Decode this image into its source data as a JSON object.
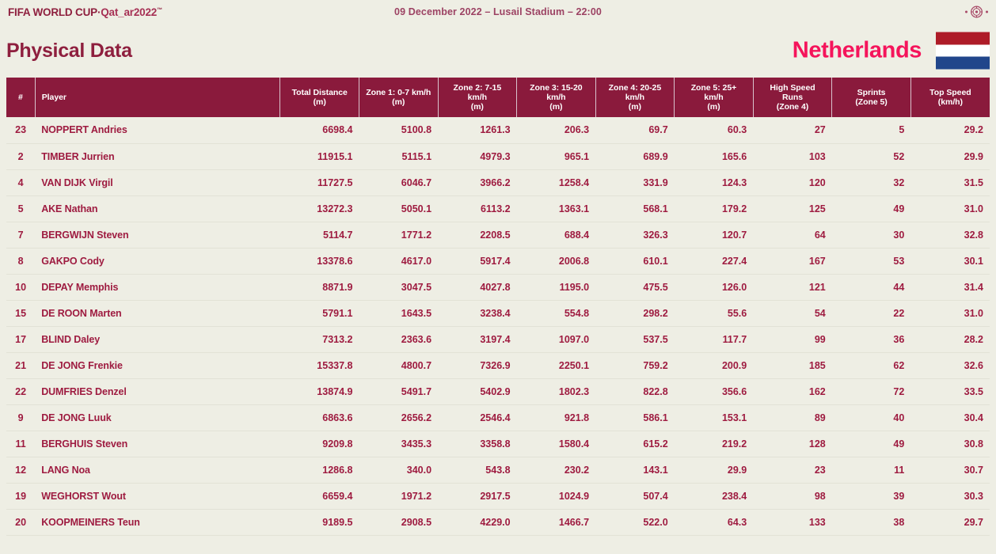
{
  "header": {
    "fifa_logo_main": "FIFA WORLD CUP",
    "fifa_logo_separator": "·",
    "fifa_logo_qatar": "Qat_ar2022",
    "fifa_logo_tm": "™",
    "match_info": "09 December 2022 – Lusail Stadium – 22:00",
    "emblem_icon": "fifa-emblem-icon"
  },
  "title": {
    "page_title": "Physical Data",
    "team_name": "Netherlands",
    "flag_icon": "netherlands-flag-icon"
  },
  "colors": {
    "page_background": "#eeeee4",
    "header_maroon": "#8a1a3c",
    "title_maroon": "#8e1f3e",
    "team_pink": "#f5145b",
    "data_text": "#9e1b40",
    "match_info_text": "#9c4263",
    "row_divider": "#e2e2d6",
    "flag_red": "#ae1c28",
    "flag_white": "#ffffff",
    "flag_blue": "#21468b"
  },
  "table": {
    "columns": [
      {
        "key": "num",
        "label": "#",
        "sub": ""
      },
      {
        "key": "player",
        "label": "Player",
        "sub": ""
      },
      {
        "key": "total",
        "label": "Total Distance",
        "sub": "(m)"
      },
      {
        "key": "zone1",
        "label": "Zone 1: 0-7 km/h",
        "sub": "(m)"
      },
      {
        "key": "zone2",
        "label": "Zone 2: 7-15 km/h",
        "sub": "(m)"
      },
      {
        "key": "zone3",
        "label": "Zone 3: 15-20 km/h",
        "sub": "(m)"
      },
      {
        "key": "zone4",
        "label": "Zone 4: 20-25 km/h",
        "sub": "(m)"
      },
      {
        "key": "zone5",
        "label": "Zone 5: 25+ km/h",
        "sub": "(m)"
      },
      {
        "key": "hsr",
        "label": "High Speed Runs",
        "sub": "(Zone 4)"
      },
      {
        "key": "sprints",
        "label": "Sprints",
        "sub": "(Zone 5)"
      },
      {
        "key": "topspeed",
        "label": "Top Speed",
        "sub": "(km/h)"
      }
    ],
    "rows": [
      {
        "num": "23",
        "player": "NOPPERT Andries",
        "total": "6698.4",
        "zone1": "5100.8",
        "zone2": "1261.3",
        "zone3": "206.3",
        "zone4": "69.7",
        "zone5": "60.3",
        "hsr": "27",
        "sprints": "5",
        "topspeed": "29.2"
      },
      {
        "num": "2",
        "player": "TIMBER Jurrien",
        "total": "11915.1",
        "zone1": "5115.1",
        "zone2": "4979.3",
        "zone3": "965.1",
        "zone4": "689.9",
        "zone5": "165.6",
        "hsr": "103",
        "sprints": "52",
        "topspeed": "29.9"
      },
      {
        "num": "4",
        "player": "VAN DIJK Virgil",
        "total": "11727.5",
        "zone1": "6046.7",
        "zone2": "3966.2",
        "zone3": "1258.4",
        "zone4": "331.9",
        "zone5": "124.3",
        "hsr": "120",
        "sprints": "32",
        "topspeed": "31.5"
      },
      {
        "num": "5",
        "player": "AKE Nathan",
        "total": "13272.3",
        "zone1": "5050.1",
        "zone2": "6113.2",
        "zone3": "1363.1",
        "zone4": "568.1",
        "zone5": "179.2",
        "hsr": "125",
        "sprints": "49",
        "topspeed": "31.0"
      },
      {
        "num": "7",
        "player": "BERGWIJN Steven",
        "total": "5114.7",
        "zone1": "1771.2",
        "zone2": "2208.5",
        "zone3": "688.4",
        "zone4": "326.3",
        "zone5": "120.7",
        "hsr": "64",
        "sprints": "30",
        "topspeed": "32.8"
      },
      {
        "num": "8",
        "player": "GAKPO Cody",
        "total": "13378.6",
        "zone1": "4617.0",
        "zone2": "5917.4",
        "zone3": "2006.8",
        "zone4": "610.1",
        "zone5": "227.4",
        "hsr": "167",
        "sprints": "53",
        "topspeed": "30.1"
      },
      {
        "num": "10",
        "player": "DEPAY Memphis",
        "total": "8871.9",
        "zone1": "3047.5",
        "zone2": "4027.8",
        "zone3": "1195.0",
        "zone4": "475.5",
        "zone5": "126.0",
        "hsr": "121",
        "sprints": "44",
        "topspeed": "31.4"
      },
      {
        "num": "15",
        "player": "DE ROON Marten",
        "total": "5791.1",
        "zone1": "1643.5",
        "zone2": "3238.4",
        "zone3": "554.8",
        "zone4": "298.2",
        "zone5": "55.6",
        "hsr": "54",
        "sprints": "22",
        "topspeed": "31.0"
      },
      {
        "num": "17",
        "player": "BLIND Daley",
        "total": "7313.2",
        "zone1": "2363.6",
        "zone2": "3197.4",
        "zone3": "1097.0",
        "zone4": "537.5",
        "zone5": "117.7",
        "hsr": "99",
        "sprints": "36",
        "topspeed": "28.2"
      },
      {
        "num": "21",
        "player": "DE JONG Frenkie",
        "total": "15337.8",
        "zone1": "4800.7",
        "zone2": "7326.9",
        "zone3": "2250.1",
        "zone4": "759.2",
        "zone5": "200.9",
        "hsr": "185",
        "sprints": "62",
        "topspeed": "32.6"
      },
      {
        "num": "22",
        "player": "DUMFRIES Denzel",
        "total": "13874.9",
        "zone1": "5491.7",
        "zone2": "5402.9",
        "zone3": "1802.3",
        "zone4": "822.8",
        "zone5": "356.6",
        "hsr": "162",
        "sprints": "72",
        "topspeed": "33.5"
      },
      {
        "num": "9",
        "player": "DE JONG Luuk",
        "total": "6863.6",
        "zone1": "2656.2",
        "zone2": "2546.4",
        "zone3": "921.8",
        "zone4": "586.1",
        "zone5": "153.1",
        "hsr": "89",
        "sprints": "40",
        "topspeed": "30.4"
      },
      {
        "num": "11",
        "player": "BERGHUIS Steven",
        "total": "9209.8",
        "zone1": "3435.3",
        "zone2": "3358.8",
        "zone3": "1580.4",
        "zone4": "615.2",
        "zone5": "219.2",
        "hsr": "128",
        "sprints": "49",
        "topspeed": "30.8"
      },
      {
        "num": "12",
        "player": "LANG Noa",
        "total": "1286.8",
        "zone1": "340.0",
        "zone2": "543.8",
        "zone3": "230.2",
        "zone4": "143.1",
        "zone5": "29.9",
        "hsr": "23",
        "sprints": "11",
        "topspeed": "30.7"
      },
      {
        "num": "19",
        "player": "WEGHORST Wout",
        "total": "6659.4",
        "zone1": "1971.2",
        "zone2": "2917.5",
        "zone3": "1024.9",
        "zone4": "507.4",
        "zone5": "238.4",
        "hsr": "98",
        "sprints": "39",
        "topspeed": "30.3"
      },
      {
        "num": "20",
        "player": "KOOPMEINERS Teun",
        "total": "9189.5",
        "zone1": "2908.5",
        "zone2": "4229.0",
        "zone3": "1466.7",
        "zone4": "522.0",
        "zone5": "64.3",
        "hsr": "133",
        "sprints": "38",
        "topspeed": "29.7"
      }
    ]
  }
}
